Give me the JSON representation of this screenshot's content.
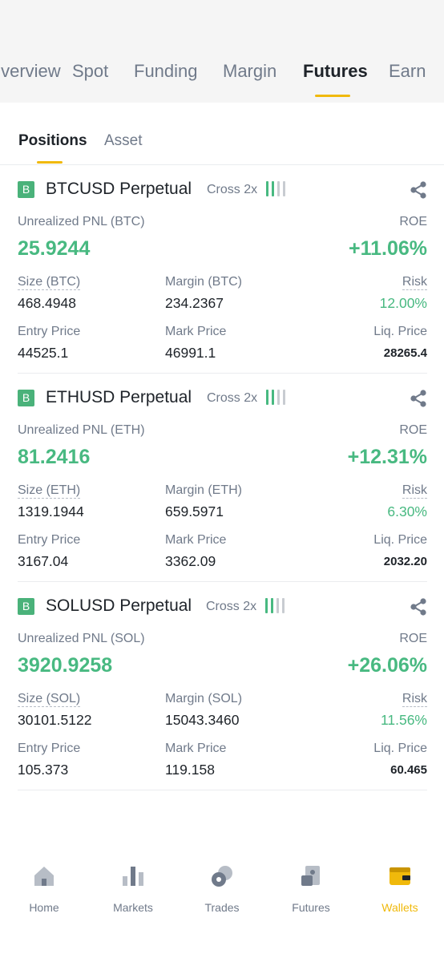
{
  "main_tabs": [
    "Overview",
    "Spot",
    "Funding",
    "Margin",
    "Futures",
    "Earn"
  ],
  "sub_tabs": [
    "Positions",
    "Asset"
  ],
  "positions": [
    {
      "badge": "B",
      "symbol": "BTCUSD Perpetual",
      "mode": "Cross 2x",
      "pnl_label": "Unrealized PNL (BTC)",
      "pnl": "25.9244",
      "roe_label": "ROE",
      "roe": "+11.06%",
      "size_label": "Size (BTC)",
      "size": "468.4948",
      "margin_label": "Margin (BTC)",
      "margin": "234.2367",
      "risk_label": "Risk",
      "risk": "12.00%",
      "entry_label": "Entry Price",
      "entry": "44525.1",
      "mark_label": "Mark Price",
      "mark": "46991.1",
      "liq_label": "Liq. Price",
      "liq": "28265.4"
    },
    {
      "badge": "B",
      "symbol": "ETHUSD Perpetual",
      "mode": "Cross 2x",
      "pnl_label": "Unrealized PNL (ETH)",
      "pnl": "81.2416",
      "roe_label": "ROE",
      "roe": "+12.31%",
      "size_label": "Size (ETH)",
      "size": "1319.1944",
      "margin_label": "Margin (ETH)",
      "margin": "659.5971",
      "risk_label": "Risk",
      "risk": "6.30%",
      "entry_label": "Entry Price",
      "entry": "3167.04",
      "mark_label": "Mark Price",
      "mark": "3362.09",
      "liq_label": "Liq. Price",
      "liq": "2032.20"
    },
    {
      "badge": "B",
      "symbol": "SOLUSD Perpetual",
      "mode": "Cross 2x",
      "pnl_label": "Unrealized PNL (SOL)",
      "pnl": "3920.9258",
      "roe_label": "ROE",
      "roe": "+26.06%",
      "size_label": "Size (SOL)",
      "size": "30101.5122",
      "margin_label": "Margin (SOL)",
      "margin": "15043.3460",
      "risk_label": "Risk",
      "risk": "11.56%",
      "entry_label": "Entry Price",
      "entry": "105.373",
      "mark_label": "Mark Price",
      "mark": "119.158",
      "liq_label": "Liq. Price",
      "liq": "60.465"
    }
  ],
  "bottom_nav": [
    "Home",
    "Markets",
    "Trades",
    "Futures",
    "Wallets"
  ],
  "colors": {
    "accent": "#f0b90b",
    "profit": "#48b981",
    "muted": "#707a8a",
    "text": "#1e2329"
  },
  "icons": [
    "share-icon",
    "leverage-bars-icon",
    "home-icon",
    "markets-icon",
    "trades-icon",
    "futures-icon",
    "wallet-icon"
  ]
}
